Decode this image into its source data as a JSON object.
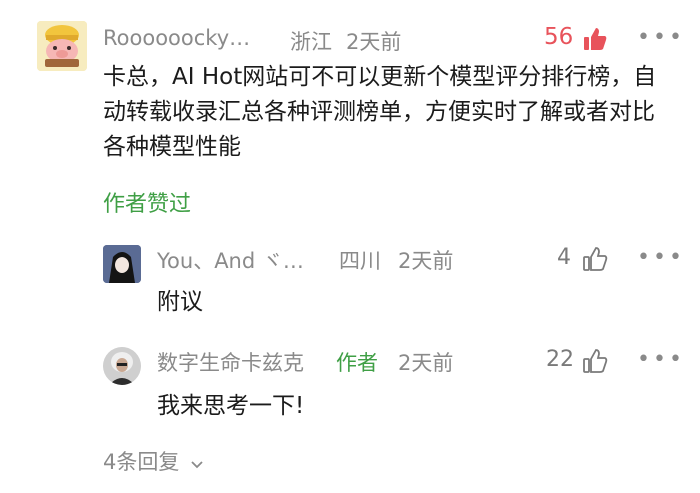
{
  "main_comment": {
    "username": "Roooooocky…",
    "location": "浙江",
    "time": "2天前",
    "likes": "56",
    "text": "卡总，AI Hot网站可不可以更新个模型评分排行榜，自动转载收录汇总各种评测榜单，方便实时了解或者对比各种模型性能",
    "author_liked": "作者赞过",
    "avatar_icon": "cartoon-pig-miner-avatar",
    "like_color": "#e8535b"
  },
  "replies": [
    {
      "username": "You、And ヾ…",
      "location": "四川",
      "time": "2天前",
      "likes": "4",
      "text": "附议",
      "avatar_icon": "anime-character-avatar"
    },
    {
      "username": "数字生命卡兹克",
      "author_tag": "作者",
      "time": "2天前",
      "likes": "22",
      "text": "我来思考一下!",
      "avatar_icon": "gray-hair-person-avatar"
    }
  ],
  "more_replies": "4条回复",
  "colors": {
    "accent_green": "#3f9f45",
    "meta_gray": "#8a8a8a"
  }
}
